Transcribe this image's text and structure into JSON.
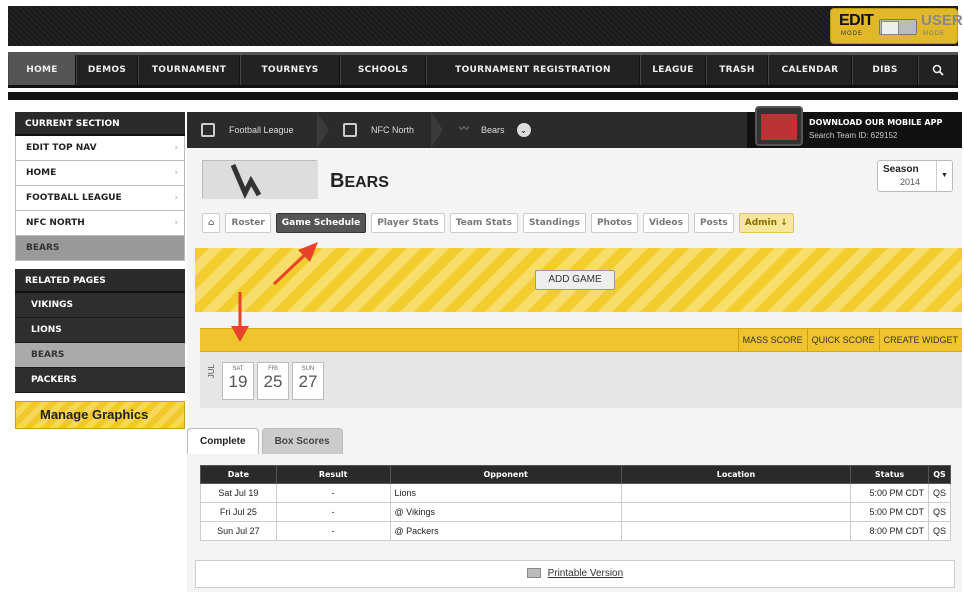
{
  "edit_mode": {
    "edit": "EDIT",
    "edit_sub": "MODE",
    "user": "USER",
    "user_sub": "MODE"
  },
  "nav": [
    {
      "label": "HOME"
    },
    {
      "label": "DEMOS"
    },
    {
      "label": "TOURNAMENT"
    },
    {
      "label": "TOURNEYS"
    },
    {
      "label": "SCHOOLS"
    },
    {
      "label": "TOURNAMENT REGISTRATION"
    },
    {
      "label": "LEAGUE"
    },
    {
      "label": "TRASH"
    },
    {
      "label": "CALENDAR"
    },
    {
      "label": "DIBS"
    }
  ],
  "sidebar": {
    "current_section_title": "CURRENT SECTION",
    "items": [
      {
        "label": "EDIT TOP NAV"
      },
      {
        "label": "HOME"
      },
      {
        "label": "FOOTBALL LEAGUE"
      },
      {
        "label": "NFC NORTH"
      },
      {
        "label": "BEARS"
      }
    ],
    "related_title": "RELATED PAGES",
    "related": [
      {
        "label": "VIKINGS"
      },
      {
        "label": "LIONS"
      },
      {
        "label": "BEARS"
      },
      {
        "label": "PACKERS"
      }
    ],
    "manage_graphics": "Manage Graphics"
  },
  "breadcrumb": {
    "league": "Football League",
    "division": "NFC North",
    "team": "Bears"
  },
  "mobile": {
    "title": "DOWNLOAD OUR MOBILE APP",
    "subtitle": "Search Team ID: 629152"
  },
  "team": {
    "first": "B",
    "rest": "EARS"
  },
  "season": {
    "label": "Season",
    "value": "2014"
  },
  "tabs": [
    {
      "label": "Roster"
    },
    {
      "label": "Game Schedule"
    },
    {
      "label": "Player Stats"
    },
    {
      "label": "Team Stats"
    },
    {
      "label": "Standings"
    },
    {
      "label": "Photos"
    },
    {
      "label": "Videos"
    },
    {
      "label": "Posts"
    },
    {
      "label": "Admin ↓"
    }
  ],
  "add_game": "ADD GAME",
  "actions": [
    {
      "label": "MASS SCORE"
    },
    {
      "label": "QUICK SCORE"
    },
    {
      "label": "CREATE WIDGET"
    }
  ],
  "month": "JUL",
  "days": [
    {
      "name": "SAT",
      "num": "19"
    },
    {
      "name": "FRI",
      "num": "25"
    },
    {
      "name": "SUN",
      "num": "27"
    }
  ],
  "subtabs": {
    "complete": "Complete",
    "box_scores": "Box Scores"
  },
  "table": {
    "headers": [
      "Date",
      "Result",
      "Opponent",
      "Location",
      "Status",
      "QS"
    ],
    "rows": [
      [
        "Sat Jul 19",
        "-",
        "Lions",
        "",
        "5:00 PM CDT",
        "QS"
      ],
      [
        "Fri Jul 25",
        "-",
        "@ Vikings",
        "",
        "5:00 PM CDT",
        "QS"
      ],
      [
        "Sun Jul 27",
        "-",
        "@ Packers",
        "",
        "8:00 PM CDT",
        "QS"
      ]
    ]
  },
  "printable": "Printable Version",
  "colors": {
    "accent": "#f0c42c",
    "dark": "#2b2b2b",
    "arrow": "#e8432a"
  }
}
